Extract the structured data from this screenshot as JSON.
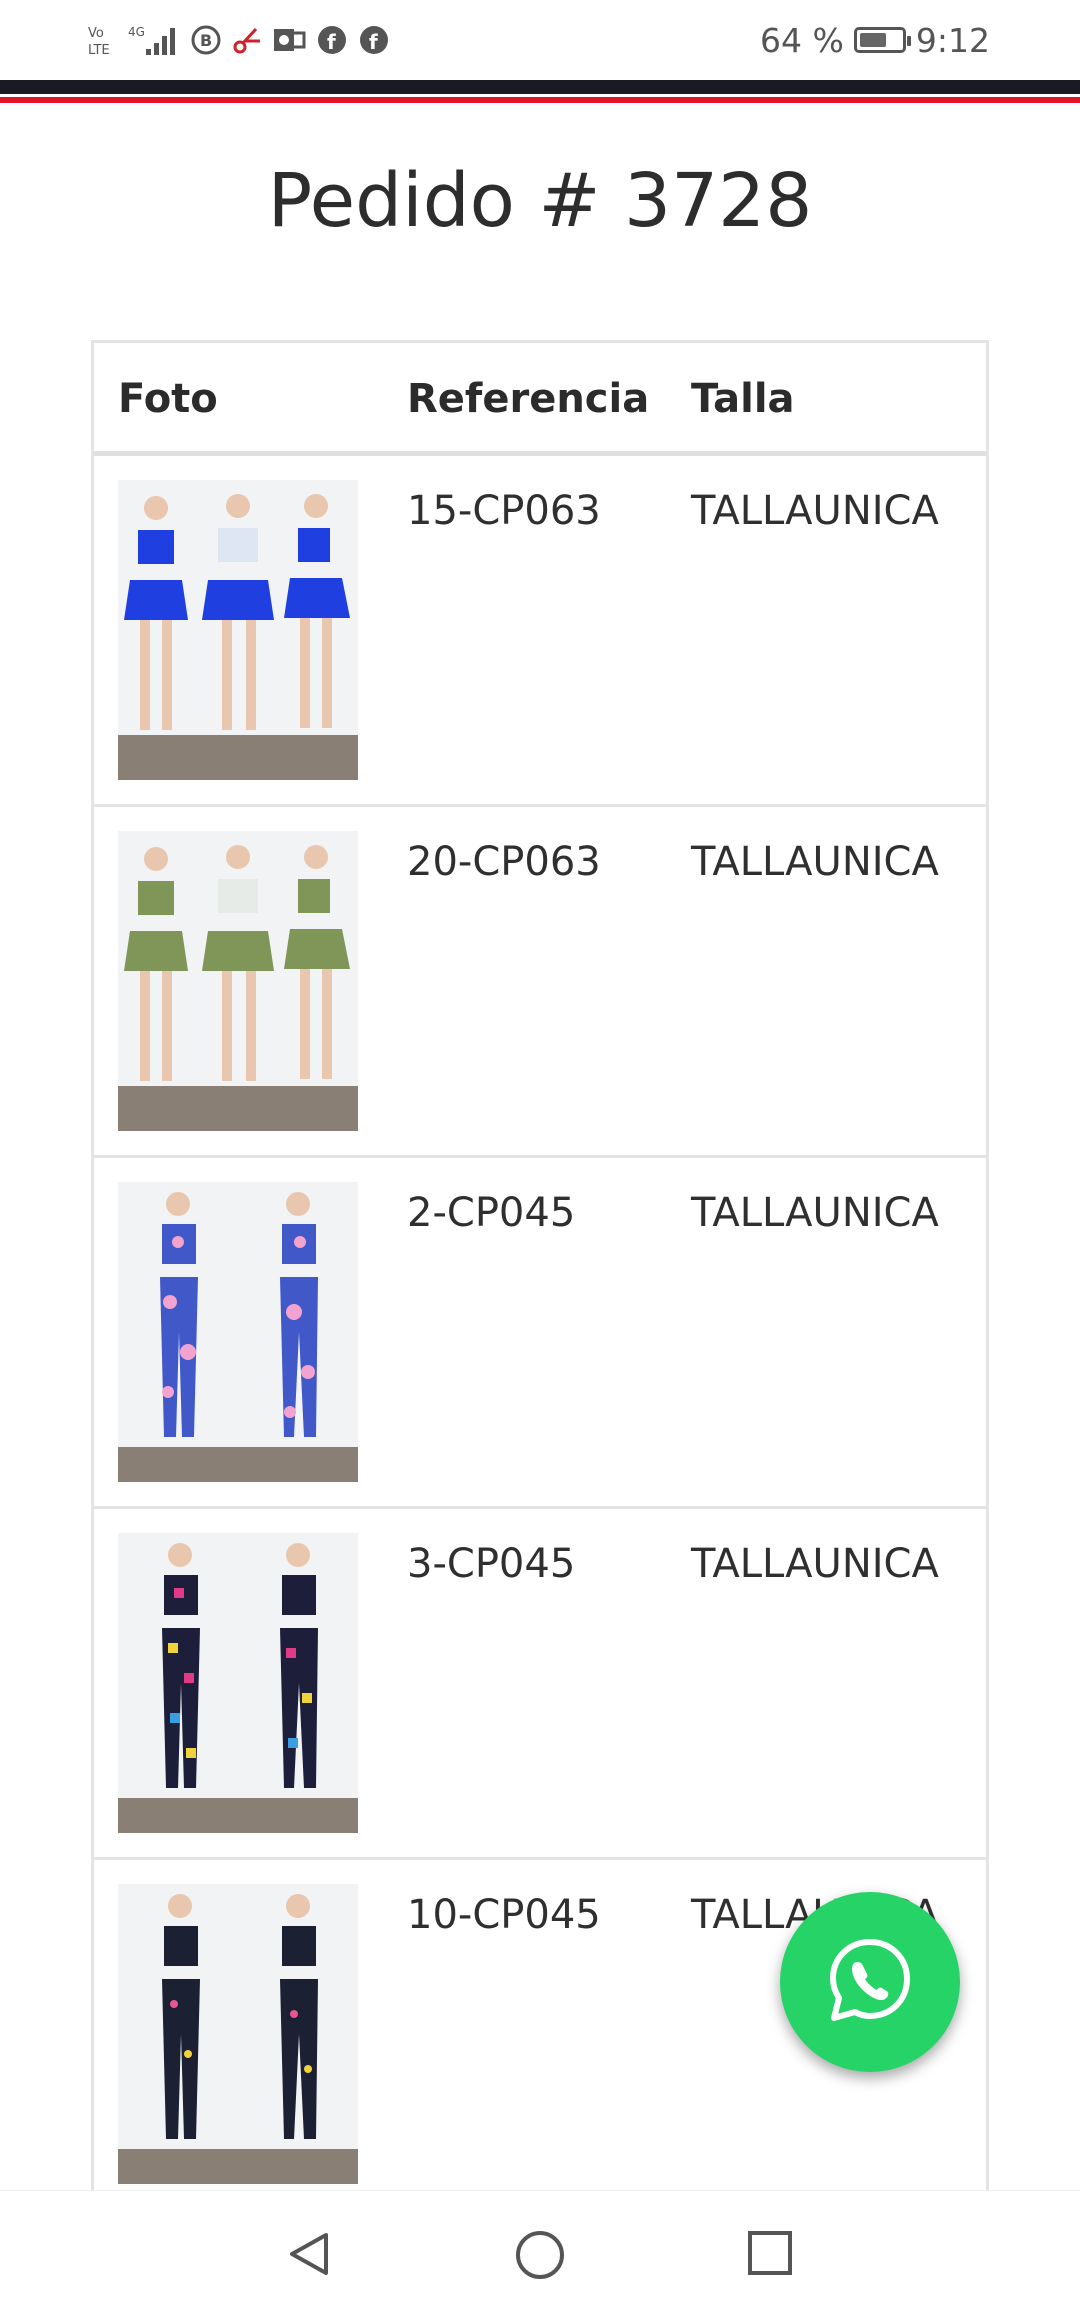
{
  "status_bar": {
    "battery_text": "64 %",
    "battery_level": 0.64,
    "time": "9:12",
    "network_label": "Vo LTE",
    "network_type": "4G"
  },
  "page": {
    "title": "Pedido # 3728"
  },
  "table": {
    "headers": {
      "photo": "Foto",
      "reference": "Referencia",
      "size": "Talla"
    },
    "rows": [
      {
        "reference": "15-CP063",
        "size": "TALLAUNICA",
        "photo_icon": "product-photo-blue-skirt-set"
      },
      {
        "reference": "20-CP063",
        "size": "TALLAUNICA",
        "photo_icon": "product-photo-green-skirt-set"
      },
      {
        "reference": "2-CP045",
        "size": "TALLAUNICA",
        "photo_icon": "product-photo-pink-blue-leggings"
      },
      {
        "reference": "3-CP045",
        "size": "TALLAUNICA",
        "photo_icon": "product-photo-multicolor-leggings"
      },
      {
        "reference": "10-CP045",
        "size": "TALLAUNICA",
        "photo_icon": "product-photo-dark-print-leggings"
      }
    ]
  },
  "fab": {
    "icon": "whatsapp-icon",
    "color": "#25d366"
  },
  "colors": {
    "accent_red": "#e0162b",
    "bar_dark": "#1a1a22"
  }
}
